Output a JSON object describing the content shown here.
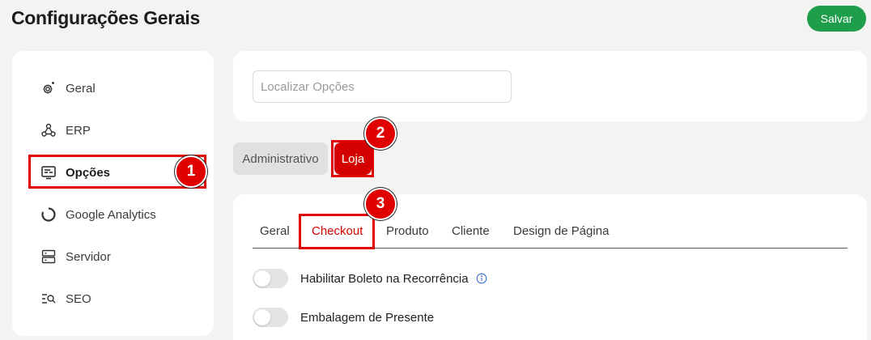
{
  "header": {
    "title": "Configurações Gerais",
    "save_label": "Salvar"
  },
  "sidebar": {
    "items": [
      {
        "label": "Geral",
        "icon": "gear-sparkle-icon"
      },
      {
        "label": "ERP",
        "icon": "webhook-icon"
      },
      {
        "label": "Opções",
        "icon": "list-box-icon",
        "active": true
      },
      {
        "label": "Google Analytics",
        "icon": "analytics-ring-icon"
      },
      {
        "label": "Servidor",
        "icon": "server-icon"
      },
      {
        "label": "SEO",
        "icon": "seo-search-icon"
      }
    ]
  },
  "search": {
    "placeholder": "Localizar Opções",
    "value": ""
  },
  "top_tabs": [
    {
      "label": "Administrativo"
    },
    {
      "label": "Loja",
      "active": true
    }
  ],
  "sub_tabs": [
    {
      "label": "Geral"
    },
    {
      "label": "Checkout",
      "active": true
    },
    {
      "label": "Produto"
    },
    {
      "label": "Cliente"
    },
    {
      "label": "Design de Página"
    }
  ],
  "options": [
    {
      "label": "Habilitar Boleto na Recorrência",
      "enabled": false,
      "has_info": true
    },
    {
      "label": "Embalagem de Presente",
      "enabled": false,
      "has_info": false
    }
  ],
  "annotations": {
    "step1": "1",
    "step2": "2",
    "step3": "3"
  },
  "colors": {
    "accent": "#d40000",
    "highlight": "#e00000",
    "save": "#1e9e4b",
    "background": "#f3f3f1"
  }
}
